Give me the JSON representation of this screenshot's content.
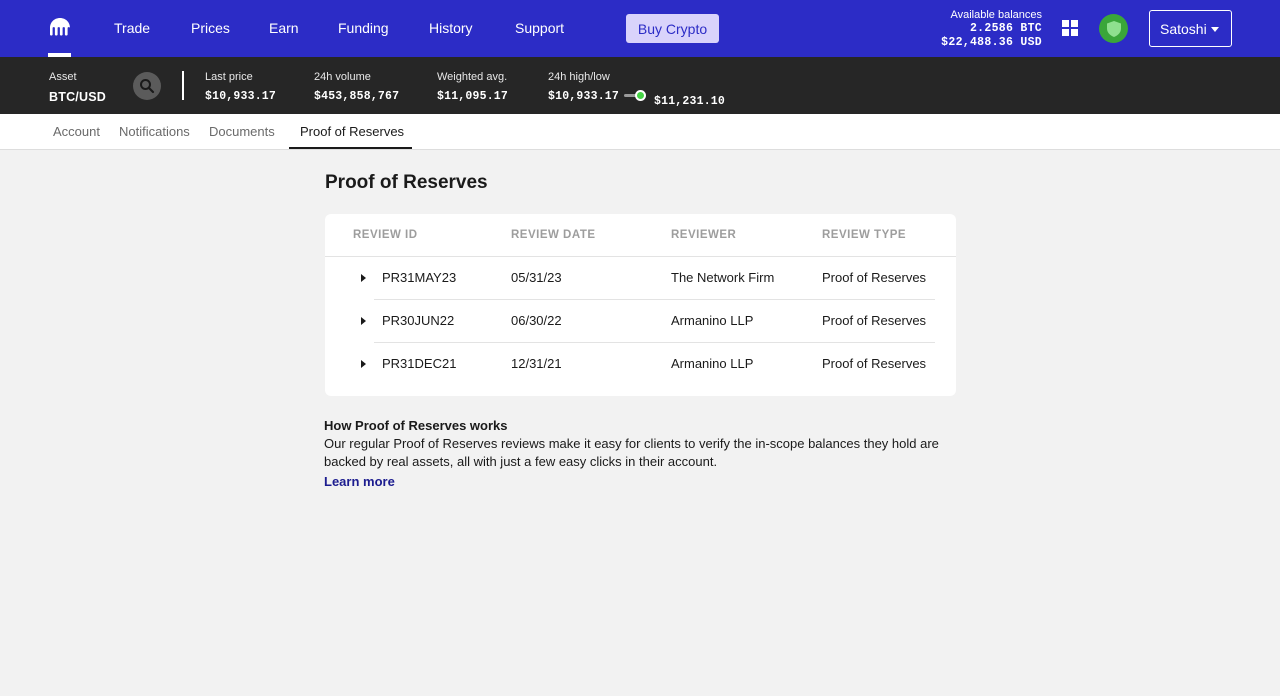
{
  "nav": {
    "items": [
      "Trade",
      "Prices",
      "Earn",
      "Funding",
      "History",
      "Support"
    ],
    "buy_label": "Buy Crypto",
    "balances_label": "Available balances",
    "balance_btc": "2.2586 BTC",
    "balance_usd": "$22,488.36 USD",
    "user_name": "Satoshi"
  },
  "ticker": {
    "asset_label": "Asset",
    "asset_value": "BTC/USD",
    "last_price_label": "Last price",
    "last_price_value": "$10,933.17",
    "volume_label": "24h volume",
    "volume_value": "$453,858,767",
    "weighted_label": "Weighted avg.",
    "weighted_value": "$11,095.17",
    "highlow_label": "24h high/low",
    "low_value": "$10,933.17",
    "high_value": "$11,231.10"
  },
  "subtabs": [
    "Account",
    "Notifications",
    "Documents",
    "Proof of Reserves"
  ],
  "main": {
    "title": "Proof of Reserves",
    "table": {
      "headers": [
        "REVIEW ID",
        "REVIEW DATE",
        "REVIEWER",
        "REVIEW TYPE"
      ],
      "rows": [
        [
          "PR31MAY23",
          "05/31/23",
          "The Network Firm",
          "Proof of Reserves"
        ],
        [
          "PR30JUN22",
          "06/30/22",
          "Armanino LLP",
          "Proof of Reserves"
        ],
        [
          "PR31DEC21",
          "12/31/21",
          "Armanino LLP",
          "Proof of Reserves"
        ]
      ]
    },
    "how_title": "How Proof of Reserves works",
    "how_text": "Our regular Proof of Reserves reviews make it easy for clients to verify the in-scope balances they hold are backed by real assets, all with just a few easy clicks in their account.",
    "learn_more": "Learn more"
  },
  "colors": {
    "nav_bg": "#2c2cc6",
    "ticker_bg": "#262626",
    "buy_bg": "#d9d3fb",
    "shield": "#3aa63a",
    "link": "#1c1c8f"
  }
}
